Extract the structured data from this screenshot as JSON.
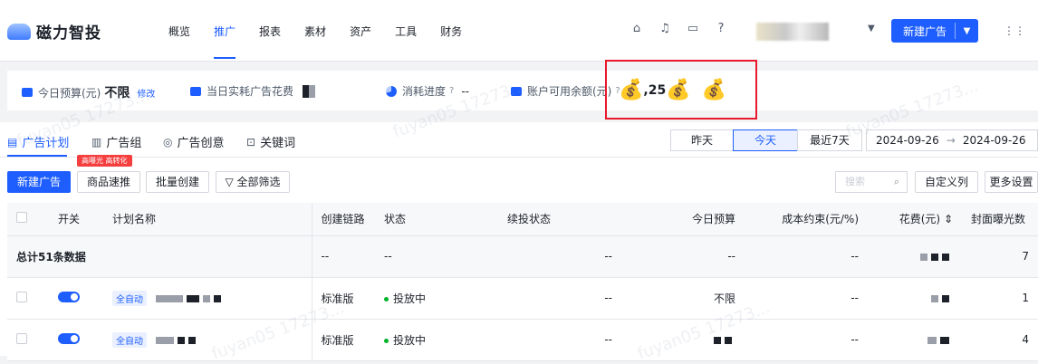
{
  "brand": {
    "name": "磁力智投"
  },
  "nav": [
    "概览",
    "推广",
    "报表",
    "素材",
    "资产",
    "工具",
    "财务"
  ],
  "nav_active_index": 1,
  "top_icons": [
    "gift-icon",
    "bell-icon",
    "message-icon",
    "help-icon"
  ],
  "header": {
    "new_ad": "新建广告"
  },
  "budget": {
    "today_budget_label": "今日预算(元)",
    "today_budget_value": "不限",
    "edit": "修改",
    "spend_label": "当日实耗广告花费",
    "progress_label": "消耗进度",
    "progress_value": "--",
    "balance_label": "账户可用余额(元)",
    "balance_partial": ",25"
  },
  "tabs": [
    "广告计划",
    "广告组",
    "广告创意",
    "关键词"
  ],
  "date_presets": [
    "昨天",
    "今天",
    "最近7天"
  ],
  "date_active_index": 1,
  "date_start": "2024-09-26",
  "date_end": "2024-09-26",
  "toolbar": {
    "hot_tag": "高曝光 高转化",
    "new_ad": "新建广告",
    "quick_promo": "商品速推",
    "batch_create": "批量创建",
    "filter": "全部筛选",
    "search_placeholder": "搜索",
    "custom_columns": "自定义列",
    "more_settings": "更多设置"
  },
  "table": {
    "columns": [
      "开关",
      "计划名称",
      "创建链路",
      "状态",
      "续投状态",
      "今日预算",
      "成本约束(元/%)",
      "花费(元)",
      "封面曝光数"
    ],
    "total_label": "总计51条数据",
    "rows": [
      {
        "name_tag": "全自动",
        "chain": "标准版",
        "status": "投放中",
        "renew": "--",
        "budget": "不限",
        "cost": "--"
      },
      {
        "name_tag": "全自动",
        "chain": "标准版",
        "status": "投放中",
        "renew": "--",
        "budget": "",
        "cost": "--"
      }
    ],
    "placeholder": "--"
  },
  "watermark": "fuyan05 17273..."
}
